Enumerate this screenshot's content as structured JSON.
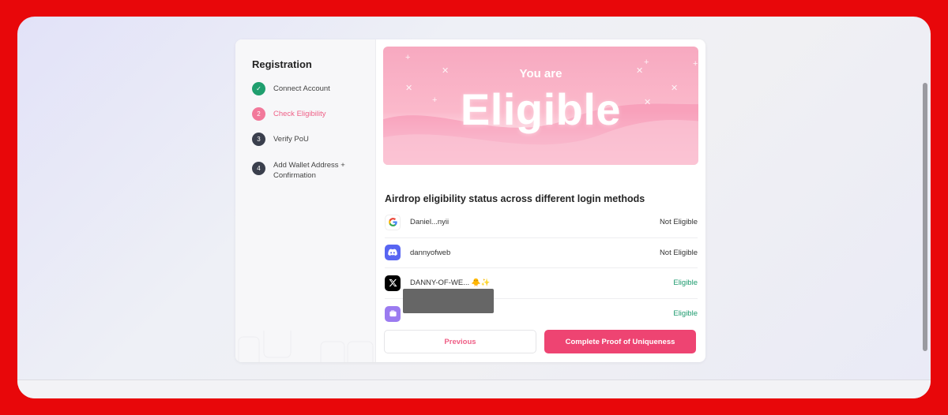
{
  "sidebar": {
    "title": "Registration",
    "steps": [
      {
        "num": "✓",
        "label": "Connect Account",
        "state": "done"
      },
      {
        "num": "2",
        "label": "Check Eligibility",
        "state": "active"
      },
      {
        "num": "3",
        "label": "Verify PoU",
        "state": "todo"
      },
      {
        "num": "4",
        "label": "Add Wallet Address + Confirmation",
        "state": "todo"
      }
    ]
  },
  "banner": {
    "subtitle": "You are",
    "title": "Eligible"
  },
  "status": {
    "heading": "Airdrop eligibility status across different login methods",
    "rows": [
      {
        "icon": "google-icon",
        "name": "Daniel...nyii",
        "status": "Not Eligible"
      },
      {
        "icon": "discord-icon",
        "name": "dannyofweb",
        "status": "Not Eligible"
      },
      {
        "icon": "x-icon",
        "name": "DANNY-OF-WE... 🐥✨",
        "status": "Eligible"
      },
      {
        "icon": "wallet-icon",
        "name": "",
        "status": "Eligible"
      }
    ]
  },
  "buttons": {
    "previous": "Previous",
    "complete": "Complete Proof of Uniqueness"
  },
  "colors": {
    "accent": "#ee4472",
    "eligible": "#1c9a6d",
    "done": "#1f9e6e",
    "frame": "#e8070a"
  }
}
